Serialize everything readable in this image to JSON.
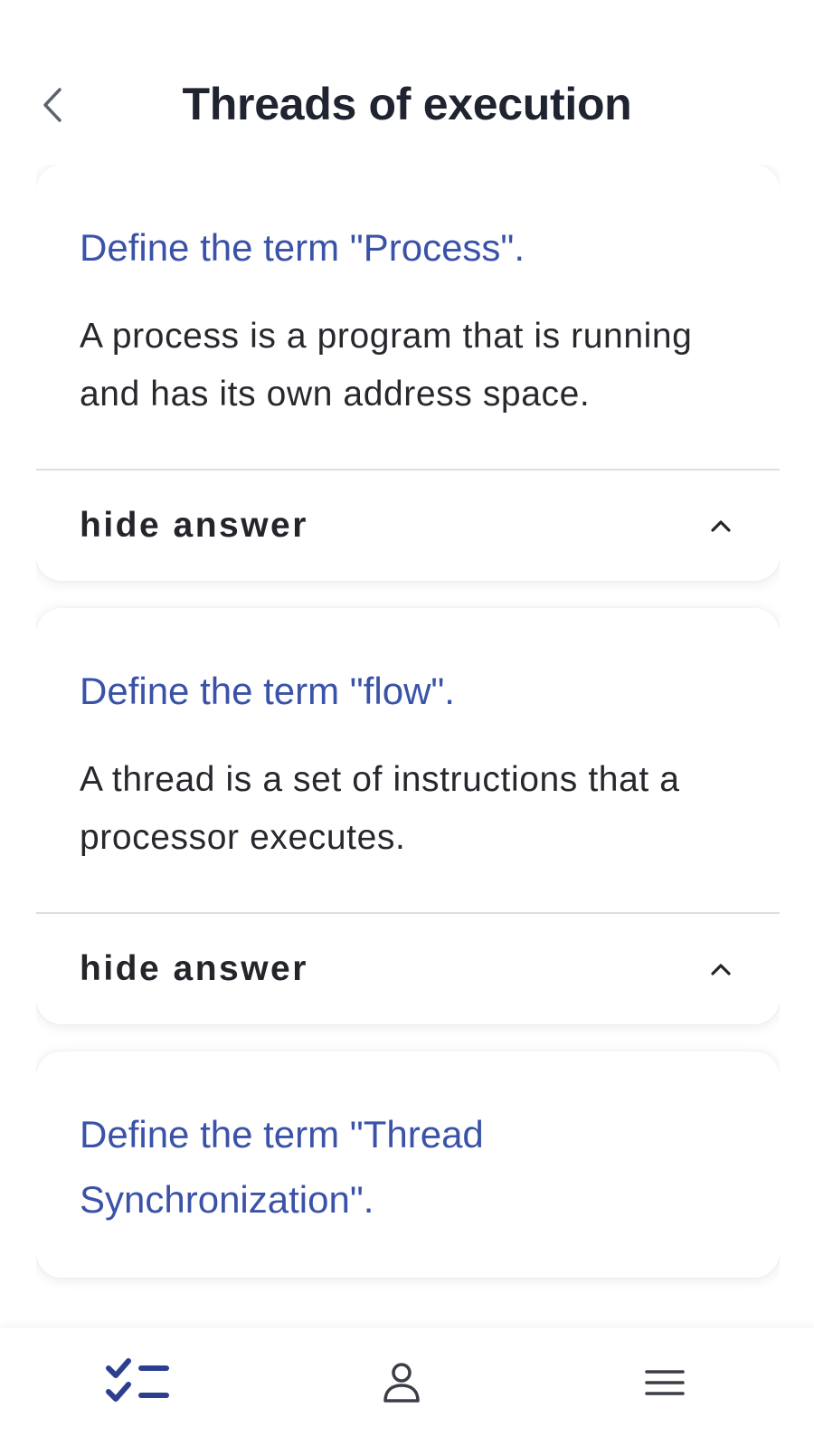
{
  "header": {
    "title": "Threads of execution",
    "back_icon": "chevron-left-icon"
  },
  "cards": [
    {
      "question": "Define the term \"Process\".",
      "answer": "A process is a program that is running and has its own address space.",
      "toggle_label": "hide answer",
      "toggle_icon": "chevron-up-icon"
    },
    {
      "question": "Define the term \"flow\".",
      "answer": "A thread is a set of instructions that a processor executes.",
      "toggle_label": "hide answer",
      "toggle_icon": "chevron-up-icon"
    },
    {
      "question": "Define the term \"Thread Synchronization\"."
    }
  ],
  "bottom_nav": {
    "items": [
      {
        "icon": "checklist-icon",
        "active": true
      },
      {
        "icon": "person-icon",
        "active": false
      },
      {
        "icon": "menu-icon",
        "active": false
      }
    ]
  },
  "colors": {
    "question_text": "#3a52a8",
    "active_nav": "#2c3f8f",
    "inactive_nav": "#3b3e46",
    "title_text": "#1f2430"
  }
}
